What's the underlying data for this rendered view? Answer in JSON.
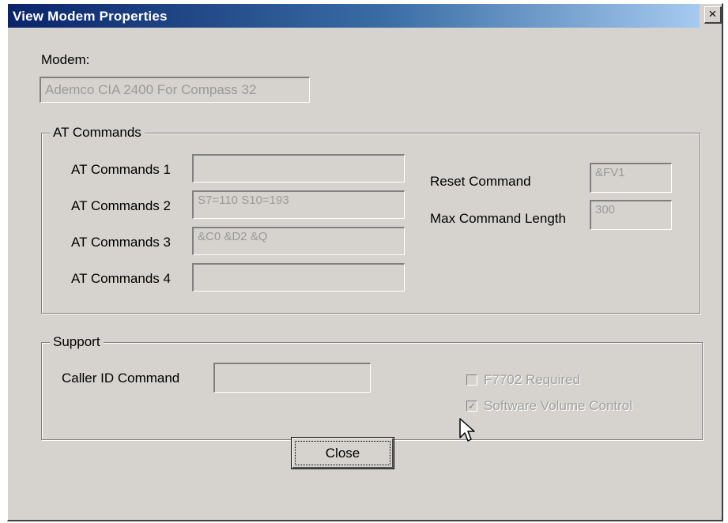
{
  "dialog": {
    "title": "View Modem Properties",
    "close_glyph": "×"
  },
  "modem": {
    "label": "Modem:",
    "value": "Ademco CIA 2400 For Compass 32"
  },
  "at_group": {
    "legend": "AT Commands",
    "rows": [
      {
        "label": "AT Commands 1",
        "value": ""
      },
      {
        "label": "AT Commands 2",
        "value": "S7=110 S10=193"
      },
      {
        "label": "AT Commands 3",
        "value": "&C0 &D2 &Q"
      },
      {
        "label": "AT Commands 4",
        "value": ""
      }
    ],
    "reset_label": "Reset Command",
    "reset_value": "&FV1",
    "maxlen_label": "Max Command Length",
    "maxlen_value": "300"
  },
  "support": {
    "legend": "Support",
    "caller_id_label": "Caller ID Command",
    "caller_id_value": "",
    "f7702_label": "F7702 Required",
    "f7702_checked": false,
    "volume_label": "Software Volume Control",
    "volume_checked": true,
    "check_glyph": "✓"
  },
  "buttons": {
    "close_label": "Close"
  },
  "icons": {
    "close": "close-icon",
    "cursor": "mouse-pointer-icon"
  }
}
